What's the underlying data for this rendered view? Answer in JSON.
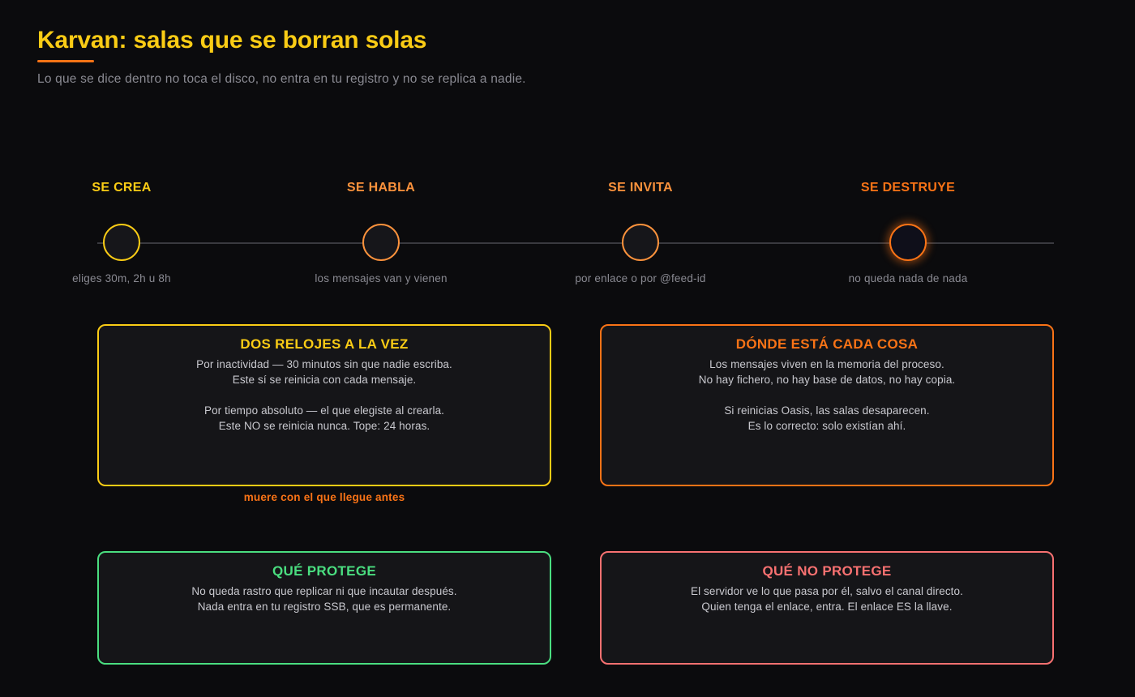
{
  "header": {
    "title": "Karvan: salas que se borran solas",
    "subtitle": "Lo que se dice dentro no toca el disco, no entra en tu registro y no se replica a nadie."
  },
  "colors": {
    "background": "#0b0b0d",
    "yellow": "#facc15",
    "orange": "#f97316",
    "green": "#4ade80",
    "red": "#f87171"
  },
  "timeline": {
    "steps": [
      {
        "label": "SE CREA",
        "caption": "eliges 30m, 2h u 8h",
        "color": "#facc15"
      },
      {
        "label": "SE HABLA",
        "caption": "los mensajes van y vienen",
        "color": "#fb923c"
      },
      {
        "label": "SE INVITA",
        "caption": "por enlace o por @feed-id",
        "color": "#fb923c"
      },
      {
        "label": "SE DESTRUYE",
        "caption": "no queda nada de nada",
        "color": "#f97316"
      }
    ]
  },
  "cards": {
    "clocks": {
      "title": "DOS RELOJES A LA VEZ",
      "lines": [
        "Por inactividad — 30 minutos sin que nadie escriba.",
        "Este sí se reinicia con cada mensaje.",
        "Por tiempo absoluto — el que elegiste al crearla.",
        "Este NO se reinicia nunca. Tope: 24 horas."
      ],
      "note": "muere con el que llegue antes"
    },
    "where": {
      "title": "DÓNDE ESTÁ CADA COSA",
      "lines": [
        "Los mensajes viven en la memoria del proceso.",
        "No hay fichero, no hay base de datos, no hay copia.",
        "Si reinicias Oasis, las salas desaparecen.",
        "Es lo correcto: solo existían ahí."
      ]
    },
    "protects": {
      "title": "QUÉ PROTEGE",
      "lines": [
        "No queda rastro que replicar ni que incautar después.",
        "Nada entra en tu registro SSB, que es permanente."
      ]
    },
    "not_protects": {
      "title": "QUÉ NO PROTEGE",
      "lines": [
        "El servidor ve lo que pasa por él, salvo el canal directo.",
        "Quien tenga el enlace, entra. El enlace ES la llave."
      ]
    }
  }
}
